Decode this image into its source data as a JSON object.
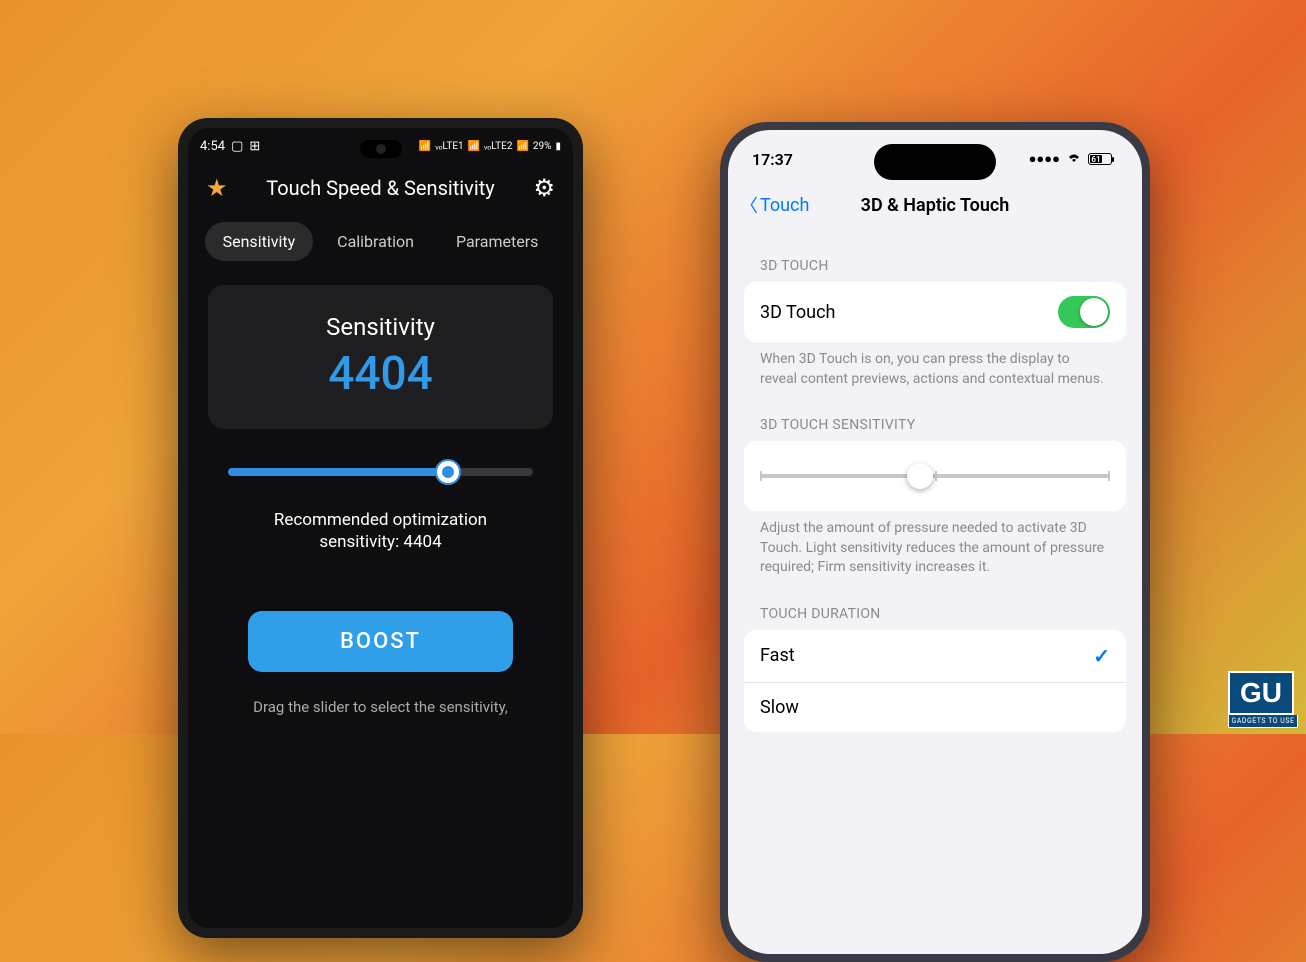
{
  "android": {
    "status": {
      "time": "4:54",
      "battery": "29%"
    },
    "appTitle": "Touch Speed & Sensitivity",
    "tabs": [
      "Sensitivity",
      "Calibration",
      "Parameters"
    ],
    "activeTab": 0,
    "sensitivityLabel": "Sensitivity",
    "sensitivityValue": "4404",
    "recommendLine1": "Recommended optimization",
    "recommendLine2": "sensitivity: 4404",
    "boostLabel": "BOOST",
    "dragHint": "Drag the slider to select the sensitivity,"
  },
  "iphone": {
    "status": {
      "time": "17:37",
      "batteryPct": "61"
    },
    "backLabel": "Touch",
    "navTitle": "3D & Haptic Touch",
    "section1Header": "3D TOUCH",
    "toggleLabel": "3D Touch",
    "toggleDesc": "When 3D Touch is on, you can press the display to reveal content previews, actions and contextual menus.",
    "section2Header": "3D TOUCH SENSITIVITY",
    "sliderDesc": "Adjust the amount of pressure needed to activate 3D Touch. Light sensitivity reduces the amount of pressure required; Firm sensitivity increases it.",
    "section3Header": "TOUCH DURATION",
    "durationOptions": [
      "Fast",
      "Slow"
    ],
    "selectedDuration": "Fast"
  },
  "watermark": {
    "logo": "GU",
    "tagline": "GADGETS TO USE"
  }
}
